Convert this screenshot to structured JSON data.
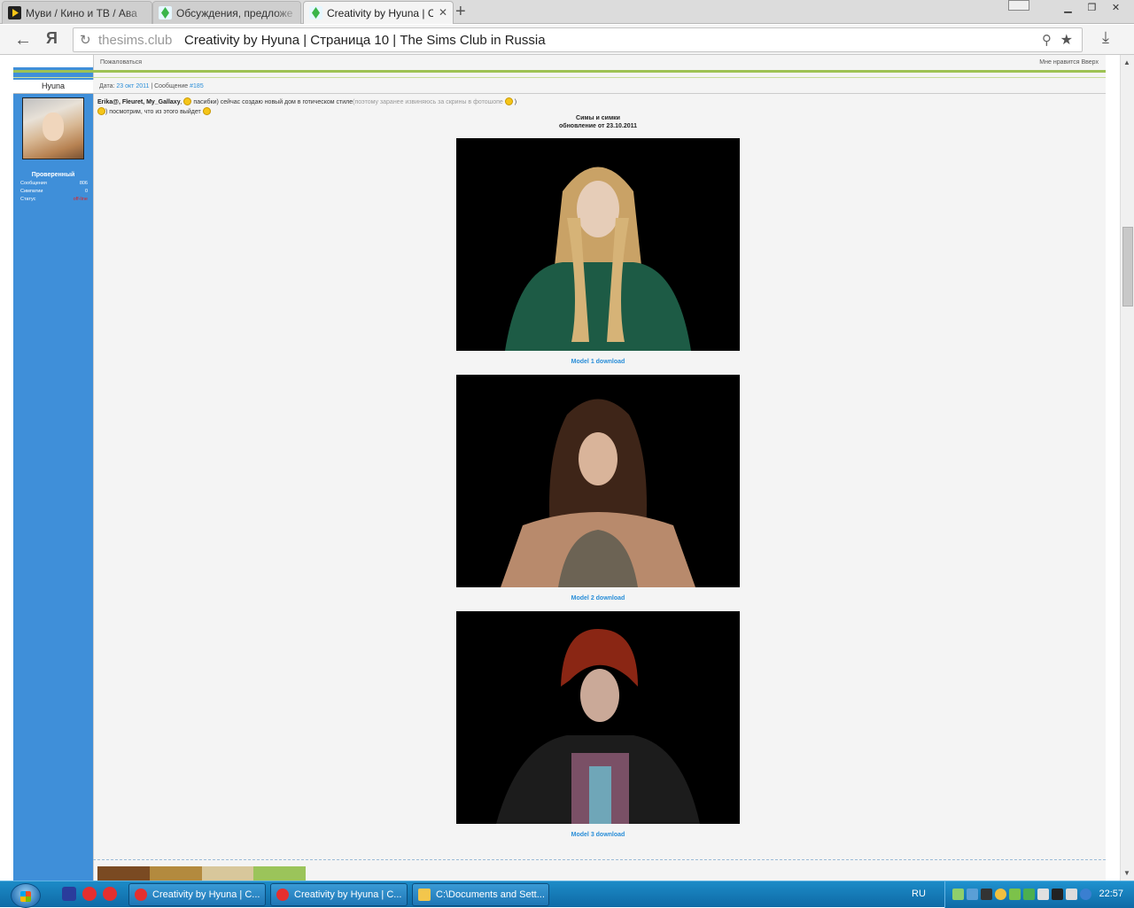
{
  "browser": {
    "tabs": [
      {
        "title": "Муви / Кино и ТВ / Ава",
        "active": false,
        "icon_color": "#f5c518"
      },
      {
        "title": "Обсуждения, предложе",
        "active": false,
        "icon_color": "#39b54a"
      },
      {
        "title": "Creativity by Hyuna | Стр",
        "active": true,
        "icon_color": "#39b54a"
      }
    ],
    "new_tab_label": "+",
    "yandex_label": "Я",
    "address": {
      "domain": "thesims.club",
      "title": "Creativity by Hyuna | Страница 10 | The Sims Club in Russia"
    }
  },
  "previous_post": {
    "complain": "Пожаловаться",
    "links": "Мне нравится     Вверх"
  },
  "post": {
    "author": "Hyuna",
    "meta": {
      "date_label": "Дата:",
      "date": "23 окт 2011",
      "sep": " | Сообщение ",
      "number": "#185"
    },
    "rank": "Проверенный",
    "stats": [
      {
        "label": "Сообщения",
        "value": "806",
        "color": "#ffffff"
      },
      {
        "label": "Симпатии",
        "value": "0",
        "color": "#ffffff"
      },
      {
        "label": "Статус",
        "value": "off-line",
        "color": "#e02020"
      }
    ],
    "text": {
      "names": "Erika@, Fleuret, My_Gallaxy",
      "line1": " пасибки) сейчас создаю новый дом в готическом стиле",
      "line1_muted": "(поэтому заранее извиняюсь за скрины в фотошопе ",
      "line1_end": " )",
      "line2": ") посмотрим, что из этого выйдет "
    },
    "title_line1": "Симы и симки",
    "title_line2": "обновление от  23.10.2011",
    "models": [
      {
        "link": "Model 1 download"
      },
      {
        "link": "Model 2 download"
      },
      {
        "link": "Model 3 download"
      }
    ]
  },
  "taskbar": {
    "tasks": [
      {
        "label": "Creativity by Hyuna | C...",
        "icon_color": "#e52f2f"
      },
      {
        "label": "Creativity by Hyuna | C...",
        "icon_color": "#e52f2f"
      },
      {
        "label": "C:\\Documents and Sett...",
        "icon_color": "#f3c64c"
      }
    ],
    "lang": "RU",
    "clock": "22:57"
  }
}
